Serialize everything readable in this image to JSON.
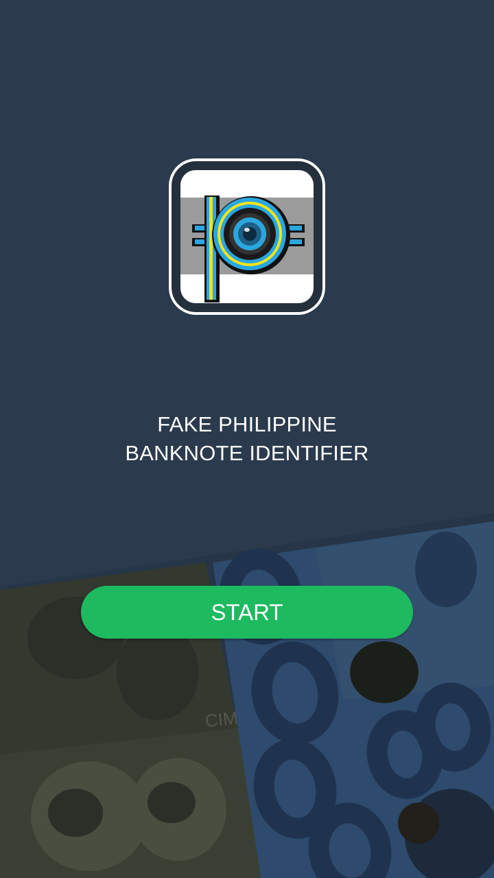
{
  "app": {
    "title_line1": "FAKE PHILIPPINE",
    "title_line2": "BANKNOTE IDENTIFIER",
    "icon": "peso-camera-logo-icon"
  },
  "actions": {
    "start_label": "START"
  },
  "colors": {
    "background": "#2b3a4d",
    "start_button": "#1dba5f",
    "logo_blue": "#2aa7df",
    "logo_yellow": "#f5e31a"
  },
  "background_art": {
    "icon": "banknote-collage-icon"
  }
}
